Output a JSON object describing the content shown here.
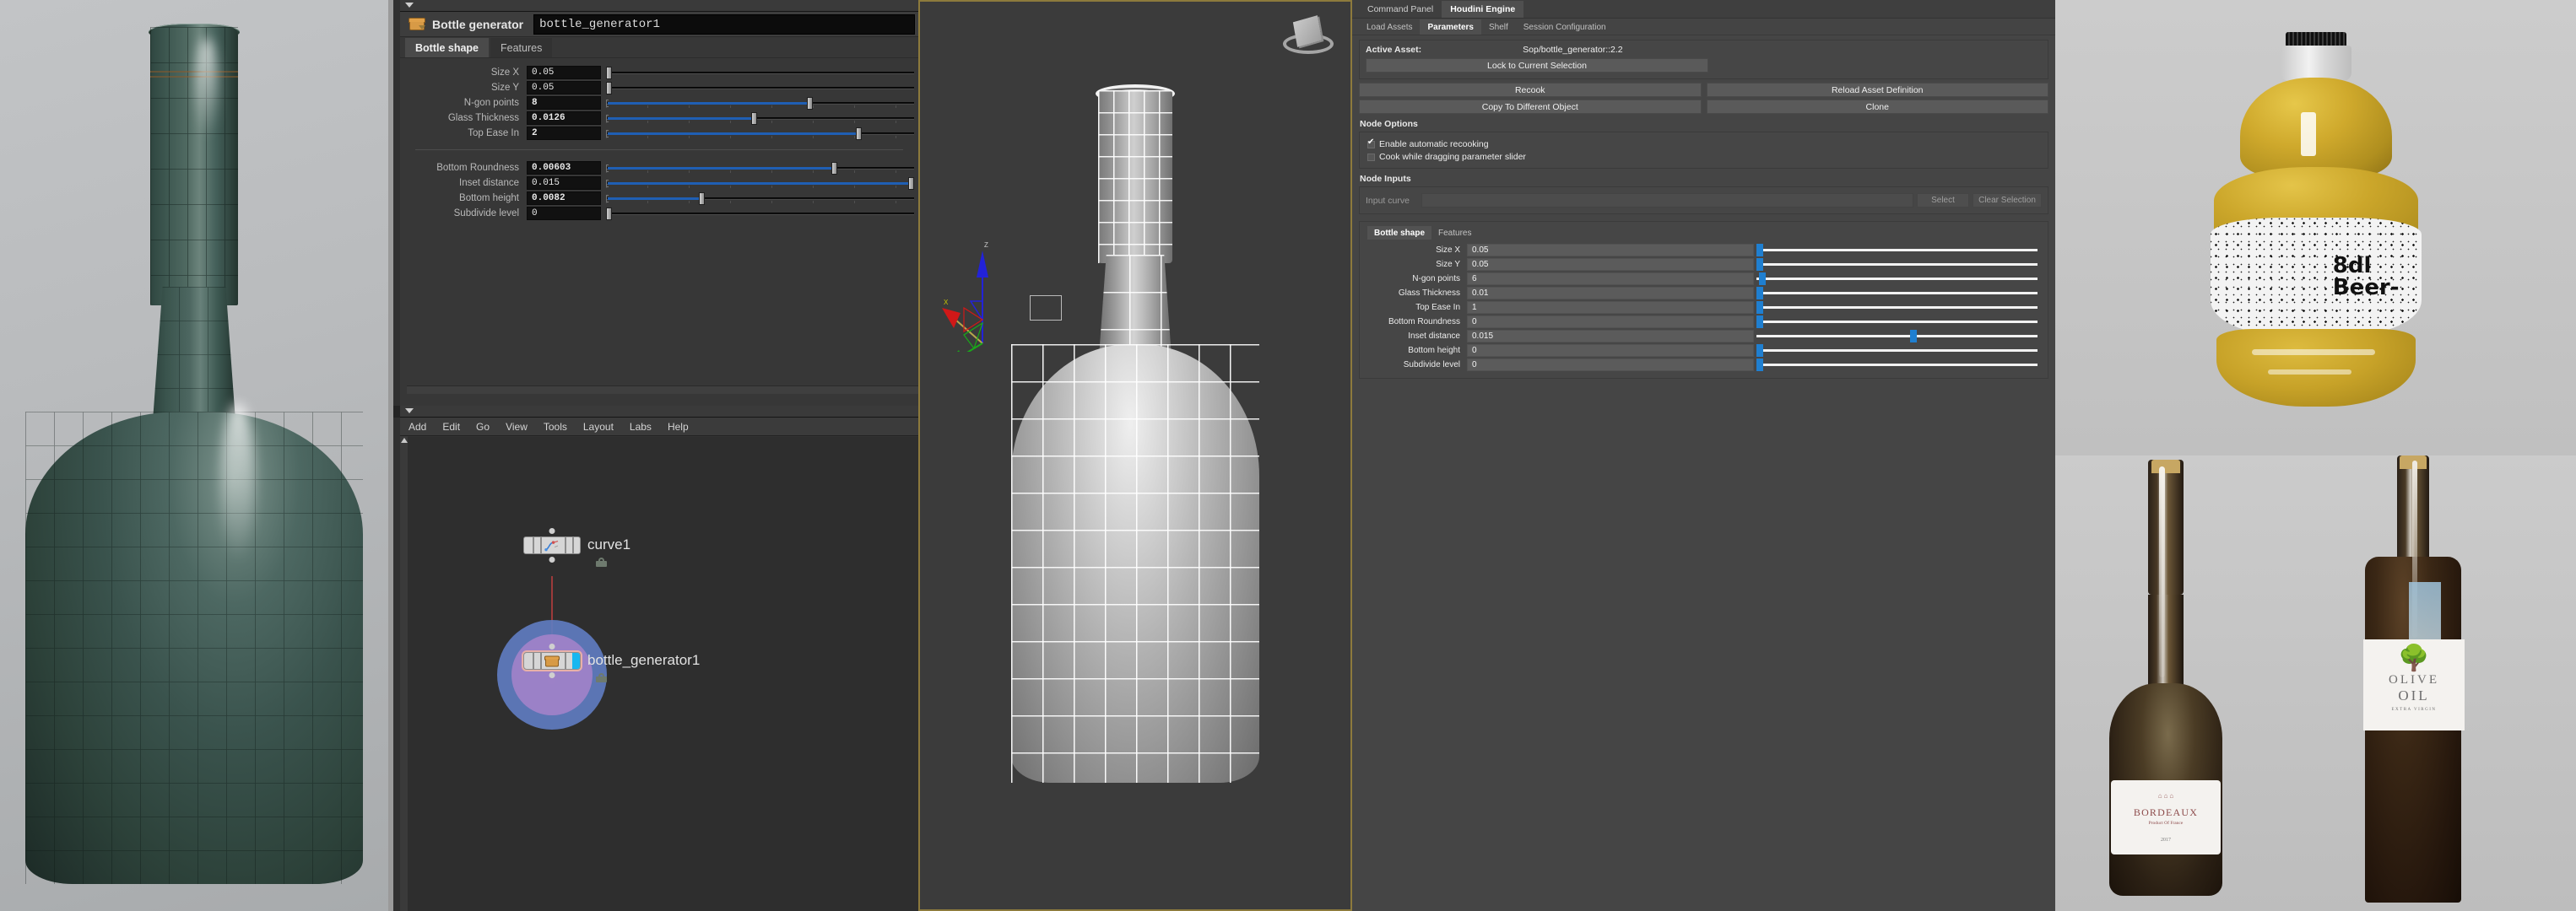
{
  "app": {
    "name": "Houdini",
    "accent_blue": "#1f5fb4",
    "engine_blue": "#1f7fd0",
    "viewport_border": "#8d7a3c"
  },
  "param_pane": {
    "node_title": "Bottle generator",
    "node_name": "bottle_generator1",
    "node_icon": "box-icon",
    "tabs": [
      {
        "label": "Bottle shape",
        "active": true
      },
      {
        "label": "Features",
        "active": false
      }
    ],
    "params_group_1": [
      {
        "label": "Size X",
        "value": "0.05",
        "bold": false,
        "fill_pct": 0,
        "knob_pct": 0
      },
      {
        "label": "Size Y",
        "value": "0.05",
        "bold": false,
        "fill_pct": 0,
        "knob_pct": 0
      },
      {
        "label": "N-gon points",
        "value": "8",
        "bold": true,
        "fill_pct": 66,
        "knob_pct": 66
      },
      {
        "label": "Glass Thickness",
        "value": "0.0126",
        "bold": true,
        "fill_pct": 48,
        "knob_pct": 48
      },
      {
        "label": "Top Ease In",
        "value": "2",
        "bold": true,
        "fill_pct": 82,
        "knob_pct": 82
      }
    ],
    "params_group_2": [
      {
        "label": "Bottom Roundness",
        "value": "0.00603",
        "bold": true,
        "fill_pct": 74,
        "knob_pct": 74
      },
      {
        "label": "Inset distance",
        "value": "0.015",
        "bold": false,
        "fill_pct": 99,
        "knob_pct": 99
      },
      {
        "label": "Bottom height",
        "value": "0.0082",
        "bold": true,
        "fill_pct": 31,
        "knob_pct": 31
      },
      {
        "label": "Subdivide level",
        "value": "0",
        "bold": false,
        "fill_pct": 0,
        "knob_pct": 0
      }
    ]
  },
  "network_editor": {
    "menu": [
      "Add",
      "Edit",
      "Go",
      "View",
      "Tools",
      "Layout",
      "Labs",
      "Help"
    ],
    "nodes": [
      {
        "name": "curve1",
        "icon": "curve-icon",
        "selected": false,
        "locked": true
      },
      {
        "name": "bottle_generator1",
        "icon": "box-icon",
        "selected": true,
        "locked": true
      }
    ]
  },
  "viewport": {
    "gnomon": "view-cube-icon",
    "axes": [
      "X",
      "Y",
      "Z"
    ],
    "axis_colors": {
      "x": "#d01818",
      "y": "#1aa81a",
      "z": "#2222d8"
    }
  },
  "houdini_engine": {
    "top_tabs": [
      {
        "label": "Command Panel",
        "active": false
      },
      {
        "label": "Houdini Engine",
        "active": true
      }
    ],
    "sub_tabs": [
      {
        "label": "Load Assets",
        "active": false
      },
      {
        "label": "Parameters",
        "active": true
      },
      {
        "label": "Shelf",
        "active": false
      },
      {
        "label": "Session Configuration",
        "active": false
      }
    ],
    "active_asset_label": "Active Asset:",
    "active_asset_path": "Sop/bottle_generator::2.2",
    "lock_button": "Lock to Current Selection",
    "buttons": [
      {
        "label": "Recook"
      },
      {
        "label": "Reload Asset Definition"
      },
      {
        "label": "Copy To Different Object"
      },
      {
        "label": "Clone"
      }
    ],
    "node_options_label": "Node Options",
    "checkboxes": [
      {
        "label": "Enable automatic recooking",
        "checked": true
      },
      {
        "label": "Cook while dragging parameter slider",
        "checked": false
      }
    ],
    "node_inputs_label": "Node Inputs",
    "input_curve_label": "Input curve",
    "input_curve_value": "",
    "select_button": "Select",
    "clear_selection_button": "Clear Selection",
    "param_tabs": [
      {
        "label": "Bottle shape",
        "active": true
      },
      {
        "label": "Features",
        "active": false
      }
    ],
    "params": [
      {
        "label": "Size X",
        "value": "0.05",
        "knob_pct": 0
      },
      {
        "label": "Size Y",
        "value": "0.05",
        "knob_pct": 0
      },
      {
        "label": "N-gon points",
        "value": "6",
        "knob_pct": 2
      },
      {
        "label": "Glass Thickness",
        "value": "0.01",
        "knob_pct": 0
      },
      {
        "label": "Top Ease In",
        "value": "1",
        "knob_pct": 0
      },
      {
        "label": "Bottom Roundness",
        "value": "0",
        "knob_pct": 0
      },
      {
        "label": "Inset distance",
        "value": "0.015",
        "knob_pct": 56
      },
      {
        "label": "Bottom height",
        "value": "0",
        "knob_pct": 0
      },
      {
        "label": "Subdivide level",
        "value": "0",
        "knob_pct": 0
      }
    ]
  },
  "photos": {
    "beer": {
      "label_line1": "8dl",
      "label_line2": "Beer-"
    },
    "wine": {
      "brand": "BORDEAUX",
      "subtitle": "Product Of France",
      "year": "2017"
    },
    "olive_oil": {
      "line1": "OLIVE",
      "line2": "OIL",
      "subtitle": "EXTRA VIRGIN"
    }
  }
}
